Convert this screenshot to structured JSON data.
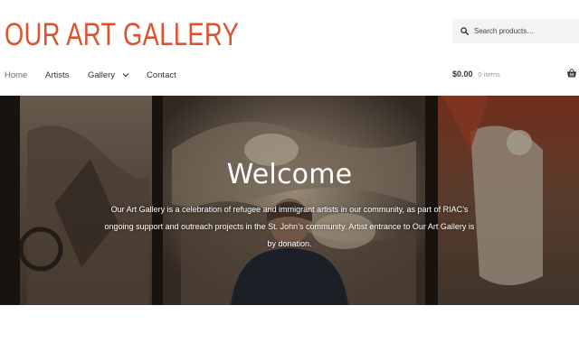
{
  "site": {
    "title": "OUR ART GALLERY",
    "brand_color": "#e0512d"
  },
  "search": {
    "placeholder": "Search products…",
    "icon": "search-icon"
  },
  "nav": {
    "items": [
      {
        "label": "Home",
        "current": true
      },
      {
        "label": "Artists"
      },
      {
        "label": "Gallery",
        "has_dropdown": true,
        "icon": "chevron-down-icon"
      },
      {
        "label": "Contact"
      }
    ]
  },
  "cart": {
    "amount": "$0.00",
    "items_text": "0 items",
    "icon": "basket-icon"
  },
  "hero": {
    "heading": "Welcome",
    "text": "Our Art Gallery is a celebration of refugee and immigrant artists in our community, as part of RIAC’s ongoing support and outreach projects in the St. John’s community. Artist entrance to Our Art Gallery is by donation."
  }
}
